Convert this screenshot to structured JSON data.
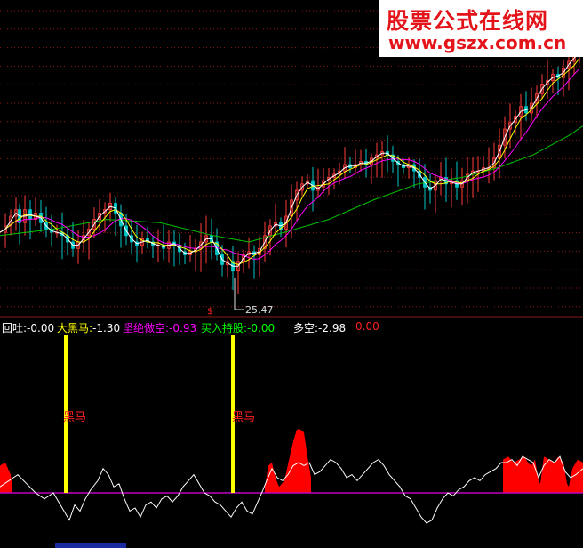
{
  "watermark": {
    "line1": "股票公式在线网",
    "line2": "www.gszx.com.cn"
  },
  "indicators": [
    {
      "name": "回吐:",
      "value": "-0.00",
      "name_color": "#ffffff",
      "value_color": "#ffffff"
    },
    {
      "name": "大黑马:",
      "value": "-1.30",
      "name_color": "#ffff00",
      "value_color": "#ffffff"
    },
    {
      "name": "坚绝做空:",
      "value": "-0.93",
      "name_color": "#ff00ff",
      "value_color": "#ff00ff"
    },
    {
      "name": "买入持股:",
      "value": "-0.00",
      "name_color": "#00ff00",
      "value_color": "#00ff00"
    },
    {
      "name": "多空:",
      "value": "-2.98",
      "name_color": "#ffffff",
      "value_color": "#ffffff"
    },
    {
      "name": "",
      "value": "0.00",
      "name_color": "#ff2020",
      "value_color": "#ff2020"
    }
  ],
  "annotations": {
    "low_price_label": "25.47",
    "signal_marker": "$",
    "heima_label": "黑马"
  },
  "colors": {
    "background": "#000000",
    "grid": "#8b1a1a",
    "separator": "#8b1a1a",
    "ma_white": "#ffffff",
    "ma_yellow": "#ffff00",
    "ma_magenta": "#ff00ff",
    "ma_green": "#00c000",
    "up_candle": "#ff3c3c",
    "down_candle": "#00c8c8",
    "histogram": "#ff0000",
    "heima_bar": "#ffff00",
    "oscillator": "#ffffff"
  },
  "chart_data": {
    "type": "candlestick_with_indicator",
    "low_label_value": 25.47,
    "price_path": [
      [
        0,
        26.9
      ],
      [
        6,
        27.1
      ],
      [
        12,
        27.4
      ],
      [
        18,
        27.6
      ],
      [
        22,
        27.2
      ],
      [
        28,
        27.6
      ],
      [
        34,
        27.3
      ],
      [
        40,
        27.5
      ],
      [
        46,
        27.2
      ],
      [
        52,
        27.0
      ],
      [
        58,
        26.9
      ],
      [
        64,
        26.9
      ],
      [
        70,
        26.8
      ],
      [
        76,
        26.6
      ],
      [
        82,
        26.4
      ],
      [
        88,
        26.6
      ],
      [
        94,
        26.8
      ],
      [
        100,
        27.0
      ],
      [
        106,
        27.3
      ],
      [
        112,
        27.5
      ],
      [
        118,
        27.6
      ],
      [
        124,
        27.8
      ],
      [
        130,
        27.5
      ],
      [
        136,
        27.1
      ],
      [
        142,
        26.8
      ],
      [
        148,
        26.6
      ],
      [
        154,
        26.5
      ],
      [
        160,
        26.7
      ],
      [
        166,
        26.6
      ],
      [
        172,
        26.5
      ],
      [
        178,
        26.5
      ],
      [
        184,
        26.4
      ],
      [
        190,
        26.6
      ],
      [
        196,
        26.5
      ],
      [
        202,
        26.3
      ],
      [
        208,
        26.2
      ],
      [
        214,
        26.3
      ],
      [
        220,
        26.4
      ],
      [
        226,
        26.6
      ],
      [
        232,
        26.8
      ],
      [
        238,
        26.6
      ],
      [
        244,
        26.2
      ],
      [
        250,
        25.9
      ],
      [
        256,
        26.0
      ],
      [
        262,
        25.7
      ],
      [
        268,
        26.0
      ],
      [
        274,
        26.2
      ],
      [
        280,
        26.3
      ],
      [
        286,
        26.2
      ],
      [
        292,
        26.4
      ],
      [
        298,
        26.8
      ],
      [
        304,
        27.1
      ],
      [
        310,
        27.2
      ],
      [
        316,
        27.0
      ],
      [
        322,
        27.4
      ],
      [
        328,
        27.9
      ],
      [
        334,
        28.2
      ],
      [
        340,
        28.4
      ],
      [
        346,
        28.5
      ],
      [
        352,
        28.2
      ],
      [
        358,
        28.3
      ],
      [
        364,
        28.5
      ],
      [
        370,
        28.6
      ],
      [
        376,
        28.7
      ],
      [
        382,
        28.8
      ],
      [
        388,
        29.0
      ],
      [
        394,
        28.9
      ],
      [
        400,
        29.0
      ],
      [
        406,
        29.1
      ],
      [
        412,
        29.0
      ],
      [
        418,
        29.2
      ],
      [
        424,
        29.3
      ],
      [
        430,
        29.4
      ],
      [
        436,
        29.3
      ],
      [
        442,
        29.1
      ],
      [
        448,
        29.0
      ],
      [
        454,
        28.9
      ],
      [
        460,
        29.0
      ],
      [
        466,
        28.8
      ],
      [
        472,
        28.6
      ],
      [
        478,
        28.3
      ],
      [
        484,
        28.2
      ],
      [
        490,
        28.5
      ],
      [
        496,
        28.6
      ],
      [
        502,
        28.4
      ],
      [
        508,
        28.5
      ],
      [
        514,
        28.3
      ],
      [
        520,
        28.5
      ],
      [
        526,
        28.7
      ],
      [
        532,
        28.8
      ],
      [
        538,
        28.8
      ],
      [
        544,
        28.9
      ],
      [
        550,
        28.9
      ],
      [
        556,
        29.2
      ],
      [
        562,
        29.6
      ],
      [
        568,
        30.1
      ],
      [
        574,
        30.3
      ],
      [
        580,
        30.5
      ],
      [
        586,
        30.8
      ],
      [
        592,
        30.6
      ],
      [
        598,
        30.9
      ],
      [
        604,
        31.2
      ],
      [
        610,
        31.5
      ],
      [
        616,
        31.6
      ],
      [
        622,
        31.8
      ],
      [
        628,
        31.7
      ],
      [
        634,
        32.0
      ],
      [
        640,
        32.2
      ],
      [
        646,
        32.4
      ],
      [
        652,
        32.6
      ]
    ],
    "ma_green_path": [
      [
        0,
        26.8
      ],
      [
        60,
        27.0
      ],
      [
        120,
        27.3
      ],
      [
        180,
        27.2
      ],
      [
        240,
        26.8
      ],
      [
        280,
        26.6
      ],
      [
        320,
        26.9
      ],
      [
        370,
        27.3
      ],
      [
        420,
        27.9
      ],
      [
        470,
        28.4
      ],
      [
        520,
        28.6
      ],
      [
        560,
        28.9
      ],
      [
        600,
        29.3
      ],
      [
        640,
        29.9
      ],
      [
        656,
        30.2
      ]
    ],
    "heima_bars": [
      74,
      262
    ],
    "histogram_segments": [
      [
        [
          0,
          0.9
        ],
        [
          6,
          1.0
        ],
        [
          12,
          0.6
        ],
        [
          14,
          0.15
        ]
      ],
      [
        [
          298,
          0.2
        ],
        [
          302,
          0.9
        ],
        [
          306,
          1.0
        ],
        [
          310,
          0.5
        ],
        [
          314,
          0.2
        ]
      ],
      [
        [
          314,
          0.2
        ],
        [
          320,
          0.4
        ],
        [
          326,
          1.2
        ],
        [
          330,
          1.7
        ],
        [
          334,
          2.1
        ],
        [
          338,
          2.1
        ],
        [
          342,
          2.0
        ],
        [
          346,
          1.2
        ],
        [
          350,
          0.5
        ]
      ],
      [
        [
          566,
          1.1
        ],
        [
          572,
          1.2
        ],
        [
          578,
          1.0
        ],
        [
          584,
          1.1
        ],
        [
          590,
          1.2
        ],
        [
          594,
          1.0
        ],
        [
          598,
          0.9
        ],
        [
          602,
          1.1
        ],
        [
          606,
          0.4
        ],
        [
          608,
          0.3
        ],
        [
          612,
          1.2
        ],
        [
          618,
          1.1
        ],
        [
          624,
          1.0
        ],
        [
          628,
          1.2
        ],
        [
          634,
          1.0
        ],
        [
          638,
          0.3
        ],
        [
          640,
          0.2
        ],
        [
          644,
          0.8
        ],
        [
          650,
          1.1
        ],
        [
          656,
          1.0
        ]
      ]
    ],
    "oscillator_path": [
      [
        0,
        0.2
      ],
      [
        10,
        0.4
      ],
      [
        20,
        0.6
      ],
      [
        30,
        0.3
      ],
      [
        40,
        0.0
      ],
      [
        50,
        -0.2
      ],
      [
        60,
        0.0
      ],
      [
        66,
        -0.3
      ],
      [
        72,
        -0.6
      ],
      [
        78,
        -0.9
      ],
      [
        84,
        -0.4
      ],
      [
        90,
        -0.6
      ],
      [
        96,
        -0.2
      ],
      [
        102,
        0.1
      ],
      [
        110,
        0.4
      ],
      [
        116,
        0.8
      ],
      [
        122,
        0.6
      ],
      [
        128,
        0.2
      ],
      [
        134,
        0.3
      ],
      [
        140,
        -0.2
      ],
      [
        146,
        -0.6
      ],
      [
        152,
        -0.5
      ],
      [
        158,
        -0.8
      ],
      [
        164,
        -0.4
      ],
      [
        170,
        -0.3
      ],
      [
        176,
        -0.5
      ],
      [
        182,
        -0.2
      ],
      [
        188,
        -0.1
      ],
      [
        194,
        -0.3
      ],
      [
        200,
        -0.1
      ],
      [
        206,
        0.2
      ],
      [
        212,
        0.4
      ],
      [
        218,
        0.6
      ],
      [
        224,
        0.3
      ],
      [
        230,
        0.0
      ],
      [
        236,
        -0.1
      ],
      [
        242,
        -0.3
      ],
      [
        248,
        -0.4
      ],
      [
        254,
        -0.6
      ],
      [
        260,
        -0.8
      ],
      [
        266,
        -0.5
      ],
      [
        272,
        -0.3
      ],
      [
        278,
        -0.6
      ],
      [
        284,
        -0.7
      ],
      [
        290,
        -0.3
      ],
      [
        296,
        0.1
      ],
      [
        300,
        0.4
      ],
      [
        306,
        0.8
      ],
      [
        312,
        0.5
      ],
      [
        318,
        0.4
      ],
      [
        324,
        0.6
      ],
      [
        330,
        0.9
      ],
      [
        336,
        1.0
      ],
      [
        342,
        0.9
      ],
      [
        348,
        1.0
      ],
      [
        354,
        0.6
      ],
      [
        360,
        0.7
      ],
      [
        366,
        0.9
      ],
      [
        372,
        1.1
      ],
      [
        378,
        1.0
      ],
      [
        384,
        0.8
      ],
      [
        390,
        0.5
      ],
      [
        396,
        0.6
      ],
      [
        402,
        0.4
      ],
      [
        408,
        0.6
      ],
      [
        414,
        0.8
      ],
      [
        420,
        1.0
      ],
      [
        426,
        1.1
      ],
      [
        432,
        0.9
      ],
      [
        438,
        0.6
      ],
      [
        444,
        0.4
      ],
      [
        450,
        0.2
      ],
      [
        456,
        -0.1
      ],
      [
        462,
        -0.2
      ],
      [
        468,
        -0.5
      ],
      [
        474,
        -0.8
      ],
      [
        480,
        -1.0
      ],
      [
        486,
        -0.9
      ],
      [
        492,
        -0.5
      ],
      [
        498,
        -0.2
      ],
      [
        504,
        0.0
      ],
      [
        510,
        -0.1
      ],
      [
        516,
        0.1
      ],
      [
        522,
        0.2
      ],
      [
        528,
        0.4
      ],
      [
        534,
        0.5
      ],
      [
        540,
        0.4
      ],
      [
        546,
        0.6
      ],
      [
        552,
        0.7
      ],
      [
        558,
        0.8
      ],
      [
        564,
        1.0
      ],
      [
        570,
        1.0
      ],
      [
        576,
        1.1
      ],
      [
        582,
        0.9
      ],
      [
        588,
        1.2
      ],
      [
        594,
        1.1
      ],
      [
        600,
        1.0
      ],
      [
        606,
        0.5
      ],
      [
        612,
        0.9
      ],
      [
        618,
        1.1
      ],
      [
        624,
        1.0
      ],
      [
        630,
        1.2
      ],
      [
        636,
        0.7
      ],
      [
        642,
        0.5
      ],
      [
        648,
        0.6
      ],
      [
        656,
        0.8
      ]
    ]
  }
}
